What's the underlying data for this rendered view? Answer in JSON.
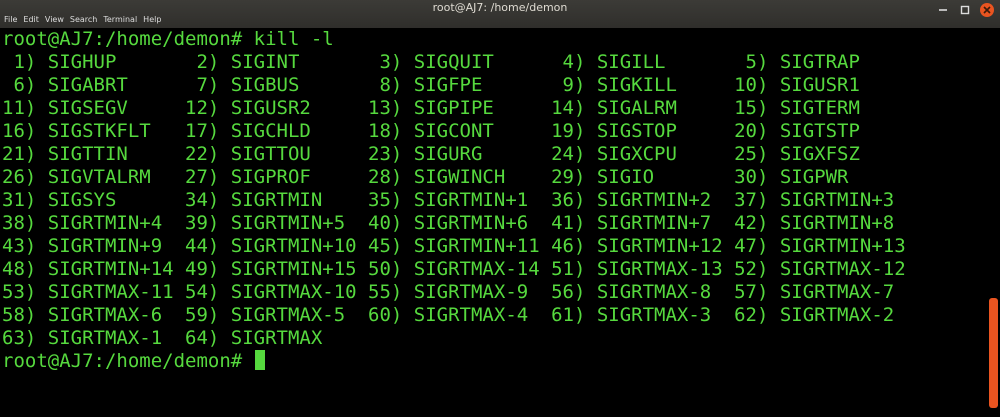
{
  "window": {
    "title": "root@AJ7: /home/demon",
    "menu": [
      "File",
      "Edit",
      "View",
      "Search",
      "Terminal",
      "Help"
    ]
  },
  "colors": {
    "terminal_fg": "#56d93e",
    "terminal_bg": "#000000",
    "accent": "#e95420"
  },
  "terminal": {
    "lines": [
      "root@AJ7:/home/demon# kill -l",
      " 1) SIGHUP       2) SIGINT       3) SIGQUIT      4) SIGILL       5) SIGTRAP",
      " 6) SIGABRT      7) SIGBUS       8) SIGFPE       9) SIGKILL     10) SIGUSR1",
      "11) SIGSEGV     12) SIGUSR2     13) SIGPIPE     14) SIGALRM     15) SIGTERM",
      "16) SIGSTKFLT   17) SIGCHLD     18) SIGCONT     19) SIGSTOP     20) SIGTSTP",
      "21) SIGTTIN     22) SIGTTOU     23) SIGURG      24) SIGXCPU     25) SIGXFSZ",
      "26) SIGVTALRM   27) SIGPROF     28) SIGWINCH    29) SIGIO       30) SIGPWR",
      "31) SIGSYS      34) SIGRTMIN    35) SIGRTMIN+1  36) SIGRTMIN+2  37) SIGRTMIN+3",
      "38) SIGRTMIN+4  39) SIGRTMIN+5  40) SIGRTMIN+6  41) SIGRTMIN+7  42) SIGRTMIN+8",
      "43) SIGRTMIN+9  44) SIGRTMIN+10 45) SIGRTMIN+11 46) SIGRTMIN+12 47) SIGRTMIN+13",
      "48) SIGRTMIN+14 49) SIGRTMIN+15 50) SIGRTMAX-14 51) SIGRTMAX-13 52) SIGRTMAX-12",
      "53) SIGRTMAX-11 54) SIGRTMAX-10 55) SIGRTMAX-9  56) SIGRTMAX-8  57) SIGRTMAX-7",
      "58) SIGRTMAX-6  59) SIGRTMAX-5  60) SIGRTMAX-4  61) SIGRTMAX-3  62) SIGRTMAX-2",
      "63) SIGRTMAX-1  64) SIGRTMAX"
    ],
    "prompt": "root@AJ7:/home/demon# "
  }
}
